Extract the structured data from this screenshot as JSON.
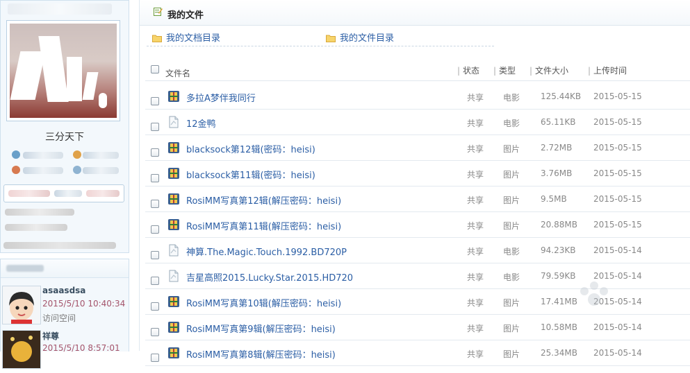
{
  "sidebar": {
    "profile_name": "三分天下",
    "visitors": [
      {
        "name": "asaasdsa",
        "time": "2015/5/10 10:40:34",
        "action": "访问空间"
      },
      {
        "name": "祥尊",
        "time": "2015/5/10 8:57:01",
        "action": ""
      }
    ]
  },
  "main": {
    "title": "我的文件",
    "folders": [
      "我的文档目录",
      "我的文件目录"
    ],
    "columns": {
      "name": "文件名",
      "status": "状态",
      "type": "类型",
      "size": "文件大小",
      "date": "上传时间"
    },
    "files": [
      {
        "name": "多拉A梦伴我同行",
        "icon": "archive",
        "status": "共享",
        "type": "电影",
        "size": "125.44KB",
        "date": "2015-05-15"
      },
      {
        "name": "12金鸭",
        "icon": "document",
        "status": "共享",
        "type": "电影",
        "size": "65.11KB",
        "date": "2015-05-15"
      },
      {
        "name": "blacksock第12辑(密码：heisi)",
        "icon": "archive",
        "status": "共享",
        "type": "图片",
        "size": "2.72MB",
        "date": "2015-05-15"
      },
      {
        "name": "blacksock第11辑(密码：heisi)",
        "icon": "archive",
        "status": "共享",
        "type": "图片",
        "size": "3.76MB",
        "date": "2015-05-15"
      },
      {
        "name": "RosiMM写真第12辑(解压密码：heisi)",
        "icon": "archive",
        "status": "共享",
        "type": "图片",
        "size": "9.5MB",
        "date": "2015-05-15"
      },
      {
        "name": "RosiMM写真第11辑(解压密码：heisi)",
        "icon": "archive",
        "status": "共享",
        "type": "图片",
        "size": "20.88MB",
        "date": "2015-05-15"
      },
      {
        "name": "神算.The.Magic.Touch.1992.BD720P",
        "icon": "document",
        "status": "共享",
        "type": "电影",
        "size": "94.23KB",
        "date": "2015-05-14"
      },
      {
        "name": "吉星高照2015.Lucky.Star.2015.HD720",
        "icon": "document",
        "status": "共享",
        "type": "电影",
        "size": "79.59KB",
        "date": "2015-05-14"
      },
      {
        "name": "RosiMM写真第10辑(解压密码：heisi)",
        "icon": "archive",
        "status": "共享",
        "type": "图片",
        "size": "17.41MB",
        "date": "2015-05-14"
      },
      {
        "name": "RosiMM写真第9辑(解压密码：heisi)",
        "icon": "archive",
        "status": "共享",
        "type": "图片",
        "size": "10.58MB",
        "date": "2015-05-14"
      },
      {
        "name": "RosiMM写真第8辑(解压密码：heisi)",
        "icon": "archive",
        "status": "共享",
        "type": "图片",
        "size": "25.34MB",
        "date": "2015-05-14"
      }
    ]
  },
  "colors": {
    "link": "#2b5ea5",
    "panel_bg": "#f3f8fc",
    "panel_border": "#cfe0ee",
    "visit_time": "#a4546b"
  }
}
